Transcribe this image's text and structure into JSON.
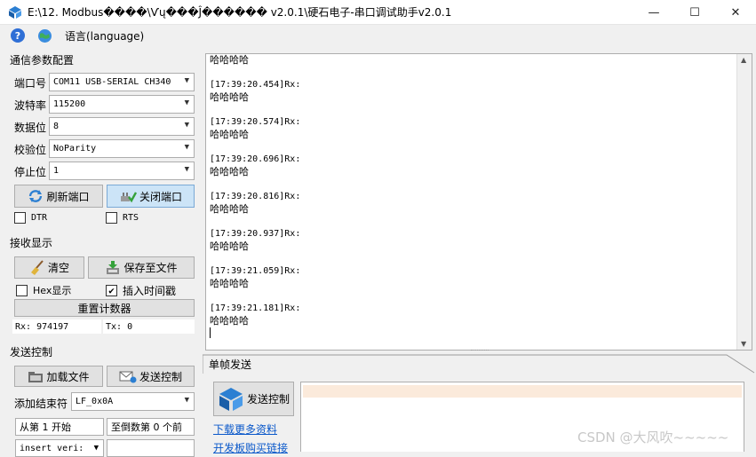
{
  "window": {
    "title": "E:\\12. Modbus����\\Ѵų���Ĵ������ v2.0.1\\硬石电子-串口调试助手v2.0.1",
    "controls": [
      "—",
      "☐",
      "✕"
    ]
  },
  "menu": {
    "help": "?",
    "language": "语言(language)"
  },
  "comm": {
    "title": "通信参数配置",
    "port_label": "端口号",
    "port_value": "COM11 USB-SERIAL CH340",
    "baud_label": "波特率",
    "baud_value": "115200",
    "databits_label": "数据位",
    "databits_value": "8",
    "parity_label": "校验位",
    "parity_value": "NoParity",
    "stopbits_label": "停止位",
    "stopbits_value": "1",
    "refresh_btn": "刷新端口",
    "close_btn": "关闭端口",
    "dtr": "DTR",
    "rts": "RTS"
  },
  "recv_display": {
    "title": "接收显示",
    "clear_btn": "清空",
    "save_btn": "保存至文件",
    "hex_label": "Hex显示",
    "hex_checked": false,
    "timestamp_label": "插入时间戳",
    "timestamp_checked": true,
    "reset_btn": "重置计数器",
    "rx": "Rx: 974197",
    "tx": "Tx: 0"
  },
  "send_control": {
    "title": "发送控制",
    "load_btn": "加载文件",
    "send_ctrl_btn": "发送控制",
    "end_char_label": "添加结束符",
    "end_char_value": "LF_0x0A",
    "from_field": "从第 1 开始",
    "count_field": "至倒数第 0 个前",
    "insert_field": "insert veri:"
  },
  "receive_log": [
    {
      "text": "哈哈哈哈",
      "cn": true
    },
    {
      "text": "",
      "cn": false
    },
    {
      "text": "[17:39:20.454]Rx:",
      "cn": false
    },
    {
      "text": "哈哈哈哈",
      "cn": true
    },
    {
      "text": "",
      "cn": false
    },
    {
      "text": "[17:39:20.574]Rx:",
      "cn": false
    },
    {
      "text": "哈哈哈哈",
      "cn": true
    },
    {
      "text": "",
      "cn": false
    },
    {
      "text": "[17:39:20.696]Rx:",
      "cn": false
    },
    {
      "text": "哈哈哈哈",
      "cn": true
    },
    {
      "text": "",
      "cn": false
    },
    {
      "text": "[17:39:20.816]Rx:",
      "cn": false
    },
    {
      "text": "哈哈哈哈",
      "cn": true
    },
    {
      "text": "",
      "cn": false
    },
    {
      "text": "[17:39:20.937]Rx:",
      "cn": false
    },
    {
      "text": "哈哈哈哈",
      "cn": true
    },
    {
      "text": "",
      "cn": false
    },
    {
      "text": "[17:39:21.059]Rx:",
      "cn": false
    },
    {
      "text": "哈哈哈哈",
      "cn": true
    },
    {
      "text": "",
      "cn": false
    },
    {
      "text": "[17:39:21.181]Rx:",
      "cn": false
    },
    {
      "text": "哈哈哈哈",
      "cn": true
    }
  ],
  "send_tab": {
    "label": "单帧发送",
    "send_btn": "发送控制",
    "download_link": "下载更多资料",
    "buy_link": "开发板购买链接"
  },
  "watermark": "CSDN @大风吹~~~~~",
  "colors": {
    "accent": "#2c7fd2",
    "link": "#0a58ca",
    "pressed": "#cce4f7",
    "highlight": "#fbeadb"
  }
}
